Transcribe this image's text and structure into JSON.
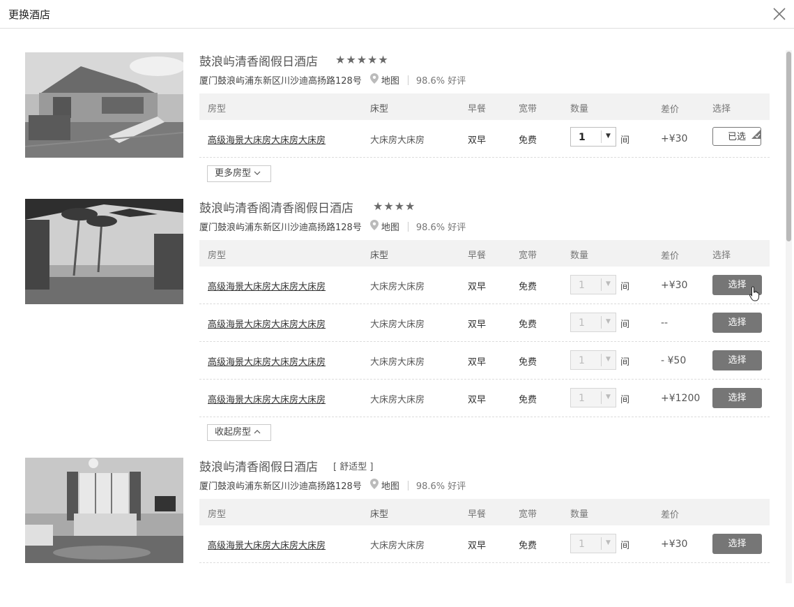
{
  "window": {
    "title": "更换酒店"
  },
  "table_headers": {
    "room": "房型",
    "bed": "床型",
    "breakfast": "早餐",
    "broadband": "宽带",
    "quantity": "数量",
    "price_diff": "差价",
    "select": "选择"
  },
  "hotels": [
    {
      "name": "鼓浪屿清香阁假日酒店",
      "stars": "★★★★★",
      "star_count": 5,
      "address": "厦门鼓浪屿浦东新区川沙迪高扬路128号",
      "map_label": "地图",
      "rating": "98.6% 好评",
      "toggle_label": "更多房型",
      "rooms": [
        {
          "room": "高级海景大床房大床房大床房",
          "bed": "大床房大床房",
          "breakfast": "双早",
          "broadband": "免费",
          "quantity": "1",
          "unit": "间",
          "price": "+¥30",
          "button": "已选",
          "selected": true
        }
      ]
    },
    {
      "name": "鼓浪屿清香阁清香阁假日酒店",
      "stars": "★★★★",
      "star_count": 4,
      "address": "厦门鼓浪屿浦东新区川沙迪高扬路128号",
      "map_label": "地图",
      "rating": "98.6% 好评",
      "toggle_label": "收起房型",
      "rooms": [
        {
          "room": "高级海景大床房大床房大床房",
          "bed": "大床房大床房",
          "breakfast": "双早",
          "broadband": "免费",
          "quantity": "1",
          "unit": "间",
          "price": "+¥30",
          "button": "选择",
          "selected": false
        },
        {
          "room": "高级海景大床房大床房大床房",
          "bed": "大床房大床房",
          "breakfast": "双早",
          "broadband": "免费",
          "quantity": "1",
          "unit": "间",
          "price": "--",
          "button": "选择",
          "selected": false
        },
        {
          "room": "高级海景大床房大床房大床房",
          "bed": "大床房大床房",
          "breakfast": "双早",
          "broadband": "免费",
          "quantity": "1",
          "unit": "间",
          "price": "- ¥50",
          "button": "选择",
          "selected": false
        },
        {
          "room": "高级海景大床房大床房大床房",
          "bed": "大床房大床房",
          "breakfast": "双早",
          "broadband": "免费",
          "quantity": "1",
          "unit": "间",
          "price": "+¥1200",
          "button": "选择",
          "selected": false
        }
      ]
    },
    {
      "name": "鼓浪屿清香阁假日酒店",
      "tag": "[ 舒适型 ]",
      "address": "厦门鼓浪屿浦东新区川沙迪高扬路128号",
      "map_label": "地图",
      "rating": "98.6% 好评",
      "rooms": [
        {
          "room": "高级海景大床房大床房大床房",
          "bed": "大床房大床房",
          "breakfast": "双早",
          "broadband": "免费",
          "quantity": "1",
          "unit": "间",
          "price": "+¥30",
          "button": "选择",
          "selected": false
        }
      ]
    }
  ],
  "colors": {
    "button_bg": "#767676",
    "header_bg": "#f2f2f2"
  }
}
